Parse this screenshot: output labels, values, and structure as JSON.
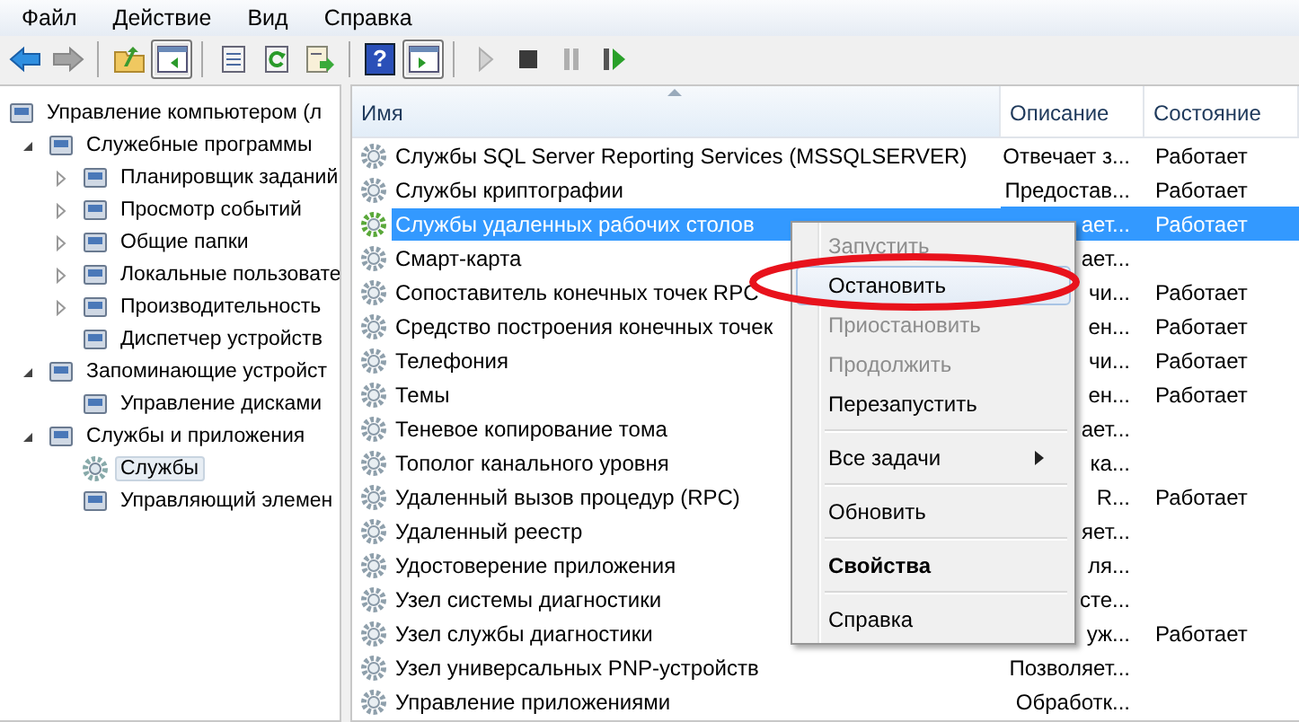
{
  "menu_bar": [
    "Файл",
    "Действие",
    "Вид",
    "Справка"
  ],
  "toolbar": [
    {
      "kind": "back",
      "pressed": false,
      "disabled": false
    },
    {
      "kind": "forward",
      "pressed": false,
      "disabled": true
    },
    {
      "kind": "separator"
    },
    {
      "kind": "up",
      "pressed": false,
      "disabled": false
    },
    {
      "kind": "tree",
      "pressed": true,
      "disabled": false
    },
    {
      "kind": "separator"
    },
    {
      "kind": "properties",
      "pressed": false,
      "disabled": false
    },
    {
      "kind": "refresh",
      "pressed": false,
      "disabled": false
    },
    {
      "kind": "export",
      "pressed": false,
      "disabled": false
    },
    {
      "kind": "separator"
    },
    {
      "kind": "help",
      "label": "?",
      "pressed": false,
      "disabled": false
    },
    {
      "kind": "pane",
      "pressed": true,
      "disabled": false
    },
    {
      "kind": "separator"
    },
    {
      "kind": "play",
      "pressed": false,
      "disabled": true
    },
    {
      "kind": "stop",
      "pressed": false,
      "disabled": false
    },
    {
      "kind": "pause",
      "pressed": false,
      "disabled": true
    },
    {
      "kind": "restart",
      "pressed": false,
      "disabled": false
    }
  ],
  "tree": [
    {
      "label": "Управление компьютером (л",
      "selected": false,
      "children": [
        {
          "label": "Служебные программы",
          "expandable": true,
          "expanded": true,
          "selected": false,
          "children": [
            {
              "label": "Планировщик заданий",
              "expandable": true,
              "expanded": false,
              "selected": false
            },
            {
              "label": "Просмотр событий",
              "expandable": true,
              "expanded": false,
              "selected": false
            },
            {
              "label": "Общие папки",
              "expandable": true,
              "expanded": false,
              "selected": false
            },
            {
              "label": "Локальные пользовате",
              "expandable": true,
              "expanded": false,
              "selected": false
            },
            {
              "label": "Производительность",
              "expandable": true,
              "expanded": false,
              "selected": false
            },
            {
              "label": "Диспетчер устройств",
              "expandable": false,
              "selected": false
            }
          ]
        },
        {
          "label": "Запоминающие устройст",
          "expandable": true,
          "expanded": true,
          "selected": false,
          "children": [
            {
              "label": "Управление дисками",
              "expandable": false,
              "selected": false
            }
          ]
        },
        {
          "label": "Службы и приложения",
          "expandable": true,
          "expanded": true,
          "selected": false,
          "children": [
            {
              "label": "Службы",
              "expandable": false,
              "selected": true
            },
            {
              "label": "Управляющий элемен",
              "expandable": false,
              "selected": false
            }
          ]
        }
      ]
    }
  ],
  "table": {
    "columns": [
      {
        "label": "Имя",
        "sorted": true
      },
      {
        "label": "Описание",
        "sorted": false
      },
      {
        "label": "Состояние",
        "sorted": false
      }
    ],
    "rows": [
      {
        "name": "Службы SQL Server Reporting Services (MSSQLSERVER)",
        "description": "Отвечает з...",
        "status": "Работает",
        "selected": false
      },
      {
        "name": "Службы криптографии",
        "description": "Предостав...",
        "status": "Работает",
        "selected": false
      },
      {
        "name": "Службы удаленных рабочих столов",
        "description": "ает...",
        "status": "Работает",
        "selected": true
      },
      {
        "name": "Смарт-карта",
        "description": "ает...",
        "selected": false
      },
      {
        "name": "Сопоставитель конечных точек RPC",
        "description": "чи...",
        "status": "Работает",
        "selected": false
      },
      {
        "name": "Средство построения конечных точек",
        "description": "ен...",
        "status": "Работает",
        "selected": false
      },
      {
        "name": "Телефония",
        "description": "чи...",
        "status": "Работает",
        "selected": false
      },
      {
        "name": "Темы",
        "description": "ен...",
        "status": "Работает",
        "selected": false
      },
      {
        "name": "Теневое копирование тома",
        "description": "ает...",
        "selected": false
      },
      {
        "name": "Тополог канального уровня",
        "description": "ка...",
        "selected": false
      },
      {
        "name": "Удаленный вызов процедур (RPC)",
        "description": "R...",
        "status": "Работает",
        "selected": false
      },
      {
        "name": "Удаленный реестр",
        "description": "яет...",
        "selected": false
      },
      {
        "name": "Удостоверение приложения",
        "description": "ля...",
        "selected": false
      },
      {
        "name": "Узел системы диагностики",
        "description": "сте...",
        "selected": false
      },
      {
        "name": "Узел службы диагностики",
        "description": "уж...",
        "status": "Работает",
        "selected": false
      },
      {
        "name": "Узел универсальных PNP-устройств",
        "description": "Позволяет...",
        "selected": false
      },
      {
        "name": "Управление приложениями",
        "description": "Обработк...",
        "selected": false
      }
    ]
  },
  "context_menu": [
    {
      "kind": "item",
      "label": "Запустить",
      "disabled": true,
      "selected": false,
      "bold": false
    },
    {
      "kind": "item",
      "label": "Остановить",
      "disabled": false,
      "selected": true,
      "bold": false
    },
    {
      "kind": "item",
      "label": "Приостановить",
      "disabled": true,
      "selected": false,
      "bold": false
    },
    {
      "kind": "item",
      "label": "Продолжить",
      "disabled": true,
      "selected": false,
      "bold": false
    },
    {
      "kind": "item",
      "label": "Перезапустить",
      "disabled": false,
      "selected": false,
      "bold": false
    },
    {
      "kind": "separator"
    },
    {
      "kind": "submenu",
      "label": "Все задачи",
      "disabled": false,
      "selected": false,
      "bold": false
    },
    {
      "kind": "separator"
    },
    {
      "kind": "item",
      "label": "Обновить",
      "disabled": false,
      "selected": false,
      "bold": false
    },
    {
      "kind": "separator"
    },
    {
      "kind": "item",
      "label": "Свойства",
      "disabled": false,
      "selected": false,
      "bold": true
    },
    {
      "kind": "separator"
    },
    {
      "kind": "item",
      "label": "Справка",
      "disabled": false,
      "selected": false,
      "bold": false
    }
  ]
}
